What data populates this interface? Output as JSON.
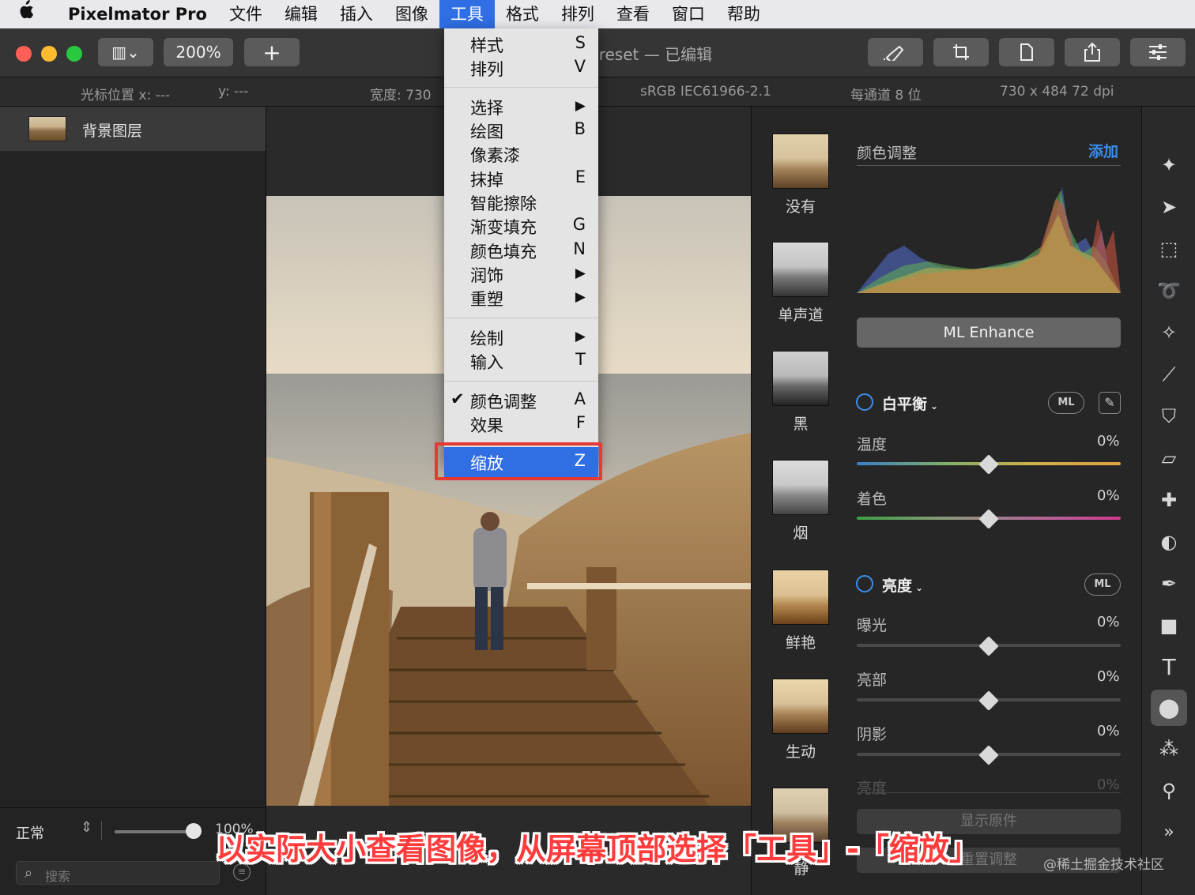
{
  "menubar": {
    "apple": "",
    "app_name": "Pixelmator Pro",
    "items": [
      "文件",
      "编辑",
      "插入",
      "图像",
      "工具",
      "格式",
      "排列",
      "查看",
      "窗口",
      "帮助"
    ],
    "active": "工具"
  },
  "toolbar": {
    "view_button": "▥⌄",
    "zoom": "200%",
    "add": "+",
    "doc_title": "preset — 已编辑"
  },
  "infobar": {
    "cursor_x": "光标位置 x:  ---",
    "cursor_y": "y:  ---",
    "width": "宽度:  730",
    "color_profile": "sRGB IEC61966-2.1",
    "bit_depth": "每通道 8 位",
    "dimensions": "730 x 484 72 dpi"
  },
  "layers": {
    "layer_name": "背景图层",
    "blend_mode": "正常",
    "opacity": "100%",
    "search_placeholder": "搜索"
  },
  "tools_menu": {
    "groups": [
      [
        {
          "label": "样式",
          "key": "S"
        },
        {
          "label": "排列",
          "key": "V"
        }
      ],
      [
        {
          "label": "选择",
          "key": "▶"
        },
        {
          "label": "绘图",
          "key": "B"
        },
        {
          "label": "像素漆",
          "key": ""
        },
        {
          "label": "抹掉",
          "key": "E"
        },
        {
          "label": "智能擦除",
          "key": ""
        },
        {
          "label": "渐变填充",
          "key": "G"
        },
        {
          "label": "颜色填充",
          "key": "N"
        },
        {
          "label": "润饰",
          "key": "▶"
        },
        {
          "label": "重塑",
          "key": "▶"
        }
      ],
      [
        {
          "label": "绘制",
          "key": "▶"
        },
        {
          "label": "输入",
          "key": "T"
        }
      ],
      [
        {
          "label": "颜色调整",
          "key": "A",
          "checked": true
        },
        {
          "label": "效果",
          "key": "F"
        }
      ]
    ],
    "zoom": {
      "label": "缩放",
      "key": "Z"
    }
  },
  "presets": [
    "没有",
    "单声道",
    "黑",
    "烟",
    "鲜艳",
    "生动",
    "静"
  ],
  "adjustments": {
    "title": "颜色调整",
    "add": "添加",
    "ml_enhance": "ML Enhance",
    "white_balance": {
      "title": "白平衡",
      "ml": "ML",
      "temperature": {
        "label": "温度",
        "value": "0%"
      },
      "tint": {
        "label": "着色",
        "value": "0%"
      }
    },
    "lightness": {
      "title": "亮度",
      "ml": "ML",
      "exposure": {
        "label": "曝光",
        "value": "0%"
      },
      "highlights": {
        "label": "亮部",
        "value": "0%"
      },
      "shadows": {
        "label": "阴影",
        "value": "0%"
      },
      "brightness": {
        "label": "亮度",
        "value": "0%"
      }
    },
    "show_original": "显示原件",
    "reset": "重置调整"
  },
  "caption": "以实际大小查看图像，从屏幕顶部选择「工具」-「缩放」",
  "watermark": "@稀土掘金技术社区",
  "colors": {
    "accent": "#2f6ee3",
    "highlight_box": "#e53935",
    "caption": "#ff3b3b"
  }
}
